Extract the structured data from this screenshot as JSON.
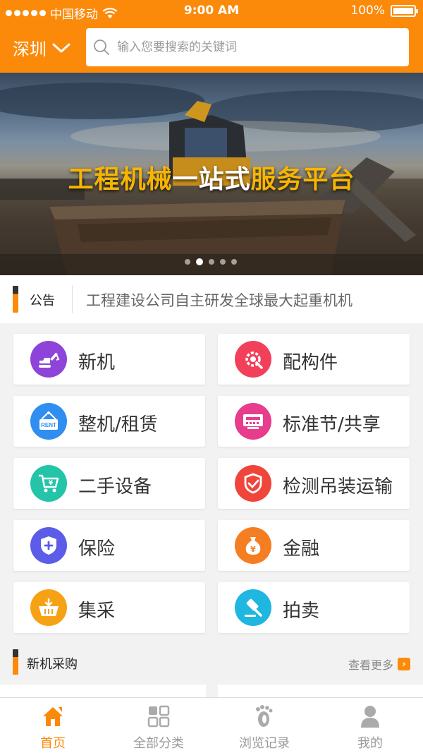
{
  "status_bar": {
    "carrier": "中国移动",
    "time": "9:00 AM",
    "battery": "100%"
  },
  "header": {
    "city": "深圳",
    "search_placeholder": "输入您要搜索的关键词"
  },
  "banner": {
    "title_parts": [
      "工程机械",
      "一站式",
      "服务平台"
    ],
    "page_count": 5,
    "active_page": 2
  },
  "notice": {
    "label": "公告",
    "text": "工程建设公司自主研发全球最大起重机机"
  },
  "categories": [
    {
      "label": "新机",
      "icon": "excavator-icon",
      "color": "#8e44d9"
    },
    {
      "label": "配构件",
      "icon": "gear-wrench-icon",
      "color": "#f2405a"
    },
    {
      "label": "整机/租赁",
      "icon": "rent-sign-icon",
      "color": "#2f8ef0"
    },
    {
      "label": "标准节/共享",
      "icon": "device-panel-icon",
      "color": "#e83c8c"
    },
    {
      "label": "二手设备",
      "icon": "cart-yen-icon",
      "color": "#23c4a8"
    },
    {
      "label": "检测吊装运输",
      "icon": "shield-check-icon",
      "color": "#f0453a"
    },
    {
      "label": "保险",
      "icon": "shield-plus-icon",
      "color": "#5b5ce8"
    },
    {
      "label": "金融",
      "icon": "money-bag-icon",
      "color": "#f57d22"
    },
    {
      "label": "集采",
      "icon": "basket-icon",
      "color": "#f7a215"
    },
    {
      "label": "拍卖",
      "icon": "gavel-icon",
      "color": "#1fb6e0"
    }
  ],
  "section": {
    "title": "新机采购",
    "more": "查看更多"
  },
  "tabbar": [
    {
      "label": "首页",
      "icon": "home-icon",
      "active": true
    },
    {
      "label": "全部分类",
      "icon": "grid-icon",
      "active": false
    },
    {
      "label": "浏览记录",
      "icon": "footprint-icon",
      "active": false
    },
    {
      "label": "我的",
      "icon": "user-icon",
      "active": false
    }
  ],
  "colors": {
    "brand": "#fb8a0b",
    "banner_accent": "#f8b500"
  }
}
